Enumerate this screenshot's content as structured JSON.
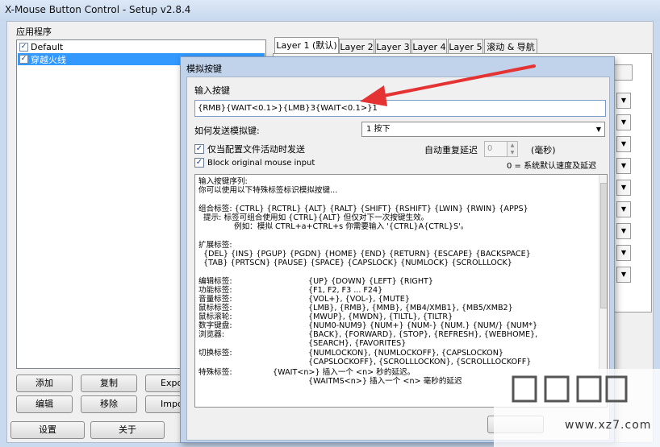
{
  "window": {
    "title": "X-Mouse Button Control - Setup v2.8.4",
    "app_group_label": "应用程序",
    "apps": [
      {
        "label": "Default",
        "checked": true,
        "selected": false
      },
      {
        "label": "穿越火线",
        "checked": true,
        "selected": true
      }
    ],
    "buttons": {
      "add": "添加",
      "copy": "复制",
      "export": "Expo",
      "edit": "编辑",
      "remove": "移除",
      "import": "Impo",
      "settings": "设置",
      "about": "关于"
    },
    "tabs": [
      {
        "label": "Layer 1 (默认)",
        "active": true
      },
      {
        "label": "Layer 2",
        "active": false
      },
      {
        "label": "Layer 3",
        "active": false
      },
      {
        "label": "Layer 4",
        "active": false
      },
      {
        "label": "Layer 5",
        "active": false
      },
      {
        "label": "滚动 & 导航",
        "active": false
      }
    ]
  },
  "dialog": {
    "title": "模拟按键",
    "input_label": "输入按键",
    "input_value": "{RMB}{WAIT<0.1>}{LMB}3{WAIT<0.1>}1",
    "send_label": "如何发送模拟键:",
    "send_value": "1 按下",
    "only_active_label": "仅当配置文件活动时发送",
    "only_active_checked": true,
    "block_label": "Block original mouse input",
    "block_checked": true,
    "repeat_label": "自动重复延迟",
    "repeat_value": "0",
    "repeat_unit": "(毫秒)",
    "repeat_note": "0 = 系统默认速度及延迟",
    "help_lines": [
      "输入按键序列:",
      "你可以使用以下特殊标签标识模拟按键...",
      "组合标签:  {CTRL} {RCTRL} {ALT} {RALT} {SHIFT} {RSHIFT} {LWIN} {RWIN} {APPS}",
      "提示:    标签可组合使用如 {CTRL}{ALT} 但仅对下一次按键生效。",
      "例如：模拟 CTRL+a+CTRL+s 你需要输入 '{CTRL}A{CTRL}S'。",
      "扩展标签:",
      "{DEL} {INS} {PGUP} {PGDN} {HOME} {END} {RETURN} {ESCAPE} {BACKSPACE}",
      "{TAB} {PRTSCN} {PAUSE} {SPACE} {CAPSLOCK} {NUMLOCK} {SCROLLLOCK}",
      "编辑标签:",
      "{UP} {DOWN} {LEFT} {RIGHT}",
      "功能标签:",
      "{F1, F2, F3 ... F24}",
      "音量标签:",
      "{VOL+}, {VOL-}, {MUTE}",
      "鼠标标签:",
      "{LMB}, {RMB}, {MMB}, {MB4/XMB1}, {MB5/XMB2}",
      "鼠标滚轮:",
      "{MWUP}, {MWDN}, {TILTL}, {TILTR}",
      "数字键盘:",
      "{NUM0-NUM9} {NUM+} {NUM-} {NUM.} {NUM/} {NUM*}",
      "浏览器:",
      "{BACK}, {FORWARD}, {STOP}, {REFRESH}, {WEBHOME},",
      "{SEARCH}, {FAVORITES}",
      "切换标签:",
      "{NUMLOCKON}, {NUMLOCKOFF}, {CAPSLOCKON}",
      "{CAPSLOCKOFF}, {SCROLLLOCKON}, {SCROLLLOCKOFF}",
      "特殊标签:",
      "{WAIT<n>} 插入一个 <n> 秒的延迟。",
      "{WAITMS<n>} 插入一个 <n> 毫秒的延迟"
    ]
  },
  "watermark": {
    "text": "www.xz7.com"
  },
  "colors": {
    "annotation_arrow": "#e53333",
    "selection": "#3399ff"
  }
}
